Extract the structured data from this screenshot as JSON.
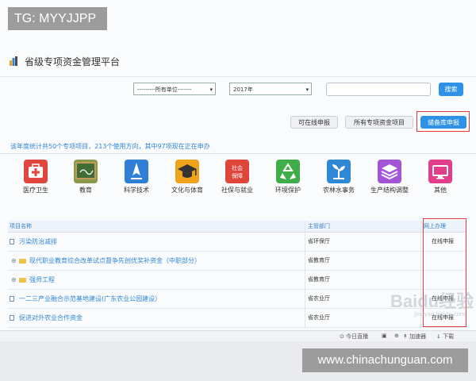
{
  "watermarks": {
    "top": "TG: MYYJJPP",
    "bottom": "www.chinachunguan.com",
    "baidu_brand": "Baidu经验",
    "baidu_sub": "jingyan.baidu.com"
  },
  "app": {
    "title": "省级专项资金管理平台"
  },
  "filters": {
    "unit_select": "---------所有单位-------",
    "year_select": "2017年",
    "search_value": "",
    "search_button": "搜索"
  },
  "actions": {
    "online_report": "可在线申报",
    "all_projects": "所有专项资金项目",
    "reserve_report": "储备库申报"
  },
  "stats_text": "该年度统计共50个专项项目，213个使用方向，其中97项现在正在申办",
  "categories": [
    {
      "label": "医疗卫生",
      "icon": "medical-kit-icon",
      "color": "#e0463f"
    },
    {
      "label": "教育",
      "icon": "chalkboard-icon",
      "color": "#8a9a4a"
    },
    {
      "label": "科学技术",
      "icon": "rocket-icon",
      "color": "#2f7fd8"
    },
    {
      "label": "文化与体育",
      "icon": "graduation-cap-icon",
      "color": "#f0a21a"
    },
    {
      "label": "社保与就业",
      "icon": "social-security-icon",
      "color": "#e0453c",
      "icon_text": "社会保障"
    },
    {
      "label": "环境保护",
      "icon": "recycle-icon",
      "color": "#3fae4a"
    },
    {
      "label": "农林水事务",
      "icon": "sprout-icon",
      "color": "#2f88d6"
    },
    {
      "label": "生产结构调整",
      "icon": "layers-icon",
      "color": "#a455d6"
    },
    {
      "label": "其他",
      "icon": "monitor-icon",
      "color": "#e23e8c"
    }
  ],
  "table": {
    "columns": [
      "项目名称",
      "主管部门",
      "网上办理"
    ],
    "rows": [
      {
        "name": "污染防治减排",
        "dept": "省环保厅",
        "action": "在线申报",
        "kind": "item"
      },
      {
        "name": "现代职业教育综合改革试点督争先创优奖补资金（中职部分）",
        "dept": "省教育厅",
        "action": "",
        "kind": "folder"
      },
      {
        "name": "强师工程",
        "dept": "省教育厅",
        "action": "",
        "kind": "folder"
      },
      {
        "name": "一二三产业融合示范基地建设(广东农业公园建设）",
        "dept": "省农业厅",
        "action": "在线申报",
        "kind": "item"
      },
      {
        "name": "促进对外农业合作资金",
        "dept": "省农业厅",
        "action": "在线申报",
        "kind": "item"
      }
    ]
  },
  "statusbar": {
    "news": "今日直播",
    "speed": "加速器",
    "download": "下载"
  }
}
